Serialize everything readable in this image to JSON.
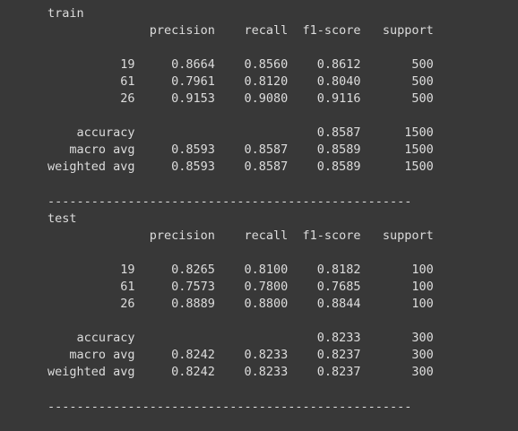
{
  "output_lines": [
    "train",
    "              precision    recall  f1-score   support",
    "",
    "          19     0.8664    0.8560    0.8612       500",
    "          61     0.7961    0.8120    0.8040       500",
    "          26     0.9153    0.9080    0.9116       500",
    "",
    "    accuracy                         0.8587      1500",
    "   macro avg     0.8593    0.8587    0.8589      1500",
    "weighted avg     0.8593    0.8587    0.8589      1500",
    "",
    "--------------------------------------------------",
    "test",
    "              precision    recall  f1-score   support",
    "",
    "          19     0.8265    0.8100    0.8182       100",
    "          61     0.7573    0.7800    0.7685       100",
    "          26     0.8889    0.8800    0.8844       100",
    "",
    "    accuracy                         0.8233       300",
    "   macro avg     0.8242    0.8233    0.8237       300",
    "weighted avg     0.8242    0.8233    0.8237       300",
    "",
    "--------------------------------------------------"
  ]
}
